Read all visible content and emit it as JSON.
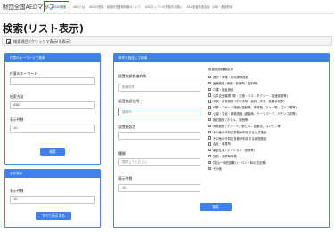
{
  "navbar": {
    "brand": "財団全国AEDマップ",
    "links": [
      {
        "label": "AEDの検索",
        "icon": "search-icon",
        "active": true
      },
      {
        "label": "AEDとは",
        "active": false
      },
      {
        "label": "AEDの登録・設置状況登録情報のリンク",
        "active": false
      },
      {
        "label": "AEDマップへの登録をお願い",
        "active": false
      },
      {
        "label": "AED設置推進会議・AED・都道府県",
        "active": false
      }
    ],
    "accent_color": "#e0201f"
  },
  "page": {
    "title": "検索(リスト表示)"
  },
  "toggle": {
    "label": "検索項目 (クリックで表示/非表示)"
  },
  "keyword_panel": {
    "header": "任意のキーワードで検索",
    "keyword_label": "任意のキーワード",
    "keyword_value": "",
    "method_label": "検索方法",
    "method_value": "AND",
    "count_label": "表示件数",
    "count_value": "10",
    "search_button": "検索"
  },
  "all_panel": {
    "header": "全件表示",
    "count_label": "表示件数",
    "count_value": "10",
    "show_all_button": "すべて表示する"
  },
  "conditions_panel": {
    "header": "条件を指定して検索",
    "prefecture_label": "設置施設都道府県",
    "prefecture_placeholder": "都道府県",
    "address_label": "設置施設住所",
    "address_placeholder": "福岡市",
    "name_label": "設置施設名",
    "name_value": "",
    "genre_label": "種類",
    "genre_placeholder": "選択してください",
    "count_label": "表示件数",
    "count_value": "10",
    "search_button": "検索",
    "facility_title": "設置施設種類区分",
    "facilities": [
      "消防・海保・防衛関係施設",
      "医療施設 (病院・診療所・歯科等)",
      "介護・福祉施設",
      "公共交通機関 (駅・空港・バス・タクシー、高速道路等)",
      "学校・保育施設 (小中学校、高校、大学、各種学校等)",
      "体育・スポーツ施設 (運動場、体育館、スキー場、ゴルフ場等)",
      "公園・文化・娯楽施設 (遊園地、テーマパーク、パチンコ店等)",
      "宿泊施設 (ホテル、旅館等)",
      "商業施設 (デパート、駅ビル、飲食店、コンビニ等)",
      "その他の不特定多数が利用する公共施設",
      "その他の不特定多数が利用する民間施設",
      "会社・事業所",
      "集合住宅 (マンション、団地等)",
      "自宅・近隣所有物",
      "貸出(一時的設置) (イベント時の貸出等)",
      "その他"
    ]
  }
}
